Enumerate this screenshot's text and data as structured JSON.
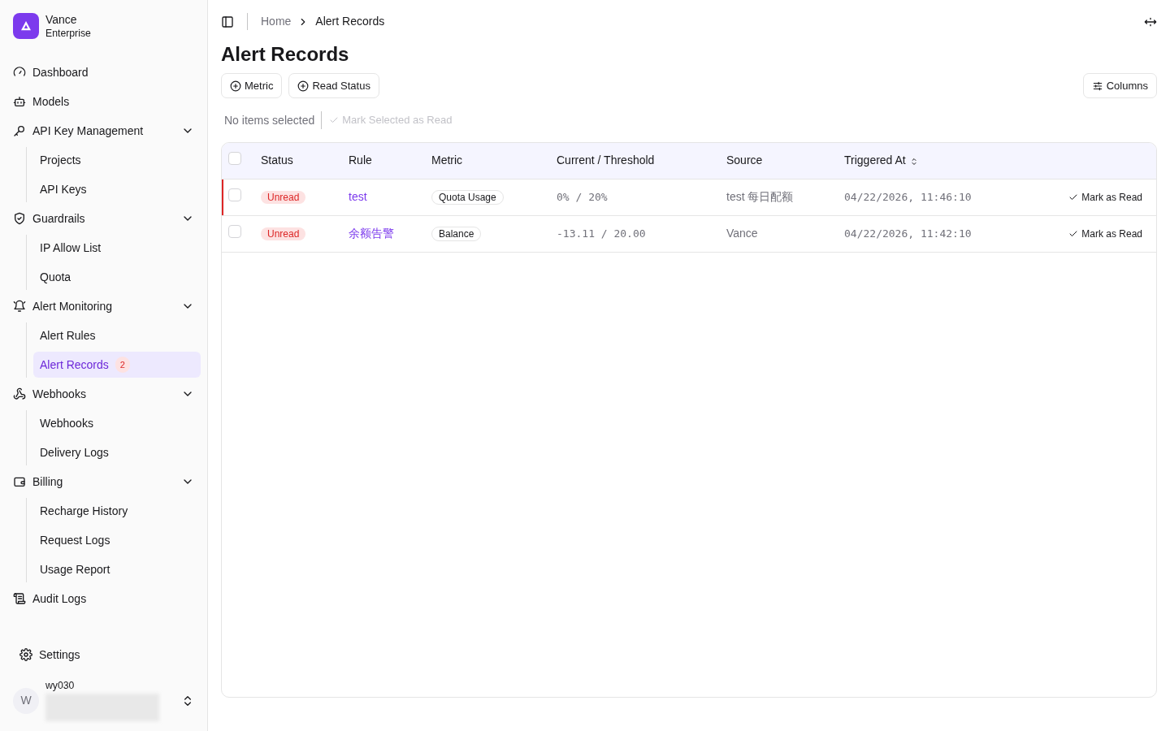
{
  "brand": {
    "name": "Vance",
    "subtitle": "Enterprise"
  },
  "sidebar": {
    "items": [
      {
        "label": "Dashboard",
        "selected": false
      },
      {
        "label": "Models",
        "selected": false
      },
      {
        "label": "API Key Management",
        "expanded": true,
        "children": [
          {
            "label": "Projects",
            "selected": false
          },
          {
            "label": "API Keys",
            "selected": false
          }
        ]
      },
      {
        "label": "Guardrails",
        "expanded": true,
        "children": [
          {
            "label": "IP Allow List",
            "selected": false
          },
          {
            "label": "Quota",
            "selected": false
          }
        ]
      },
      {
        "label": "Alert Monitoring",
        "expanded": true,
        "children": [
          {
            "label": "Alert Rules",
            "selected": false
          },
          {
            "label": "Alert Records",
            "selected": true,
            "badge": "2"
          }
        ]
      },
      {
        "label": "Webhooks",
        "expanded": true,
        "children": [
          {
            "label": "Webhooks",
            "selected": false
          },
          {
            "label": "Delivery Logs",
            "selected": false
          }
        ]
      },
      {
        "label": "Billing",
        "expanded": true,
        "children": [
          {
            "label": "Recharge History",
            "selected": false
          },
          {
            "label": "Request Logs",
            "selected": false
          },
          {
            "label": "Usage Report",
            "selected": false
          }
        ]
      },
      {
        "label": "Audit Logs",
        "selected": false
      }
    ],
    "settings": "Settings",
    "user": {
      "initial": "W",
      "name": "wy030"
    }
  },
  "breadcrumb": [
    "Home",
    "Alert Records"
  ],
  "title": "Alert Records",
  "filters": [
    "Metric",
    "Read Status"
  ],
  "columns_button": "Columns",
  "selection": {
    "text": "No items selected",
    "action": "Mark Selected as Read",
    "disabled": true
  },
  "table": {
    "select_all_checked": false,
    "columns": [
      {
        "label": "Status",
        "sortable": false
      },
      {
        "label": "Rule",
        "sortable": false
      },
      {
        "label": "Metric",
        "sortable": false
      },
      {
        "label": "Current / Threshold",
        "sortable": false
      },
      {
        "label": "Source",
        "sortable": false
      },
      {
        "label": "Triggered At",
        "sortable": true
      }
    ],
    "rows": [
      {
        "checked": false,
        "highlighted": true,
        "status": "Unread",
        "rule": "test",
        "metric": "Quota Usage",
        "value": "0% / 20%",
        "source": "test 每日配额",
        "triggered": "04/22/2026, 11:46:10",
        "action": "Mark as Read"
      },
      {
        "checked": false,
        "highlighted": false,
        "status": "Unread",
        "rule": "余额告警",
        "metric": "Balance",
        "value": "-13.11 / 20.00",
        "source": "Vance",
        "triggered": "04/22/2026, 11:42:10",
        "action": "Mark as Read"
      }
    ]
  }
}
